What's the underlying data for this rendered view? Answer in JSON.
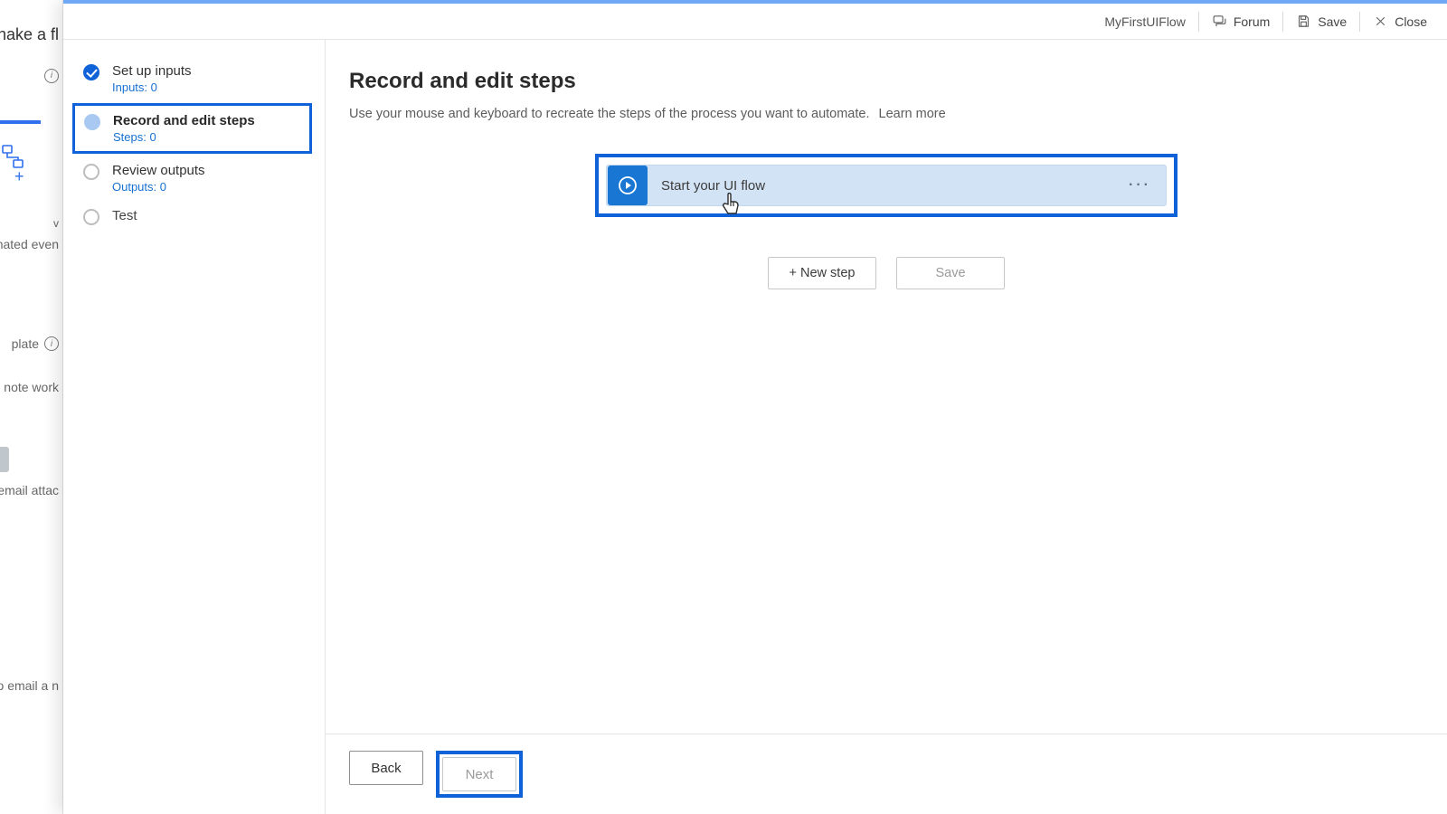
{
  "bg": {
    "title_frag": "nake a fl",
    "trigger_frag": "ignated even",
    "template_frag": "plate",
    "remote_frag": "note work",
    "attach_frag": "email attac",
    "email_frag": "o email a n"
  },
  "header": {
    "flow_name": "MyFirstUIFlow",
    "forum": "Forum",
    "save": "Save",
    "close": "Close"
  },
  "nav": {
    "inputs": {
      "title": "Set up inputs",
      "sub": "Inputs: 0"
    },
    "record": {
      "title": "Record and edit steps",
      "sub": "Steps: 0"
    },
    "outputs": {
      "title": "Review outputs",
      "sub": "Outputs: 0"
    },
    "test": {
      "title": "Test"
    }
  },
  "main": {
    "heading": "Record and edit steps",
    "desc": "Use your mouse and keyboard to recreate the steps of the process you want to automate.",
    "learn_more": "Learn more",
    "card_title": "Start your UI flow",
    "new_step": "+ New step",
    "save": "Save"
  },
  "footer": {
    "back": "Back",
    "next": "Next"
  }
}
